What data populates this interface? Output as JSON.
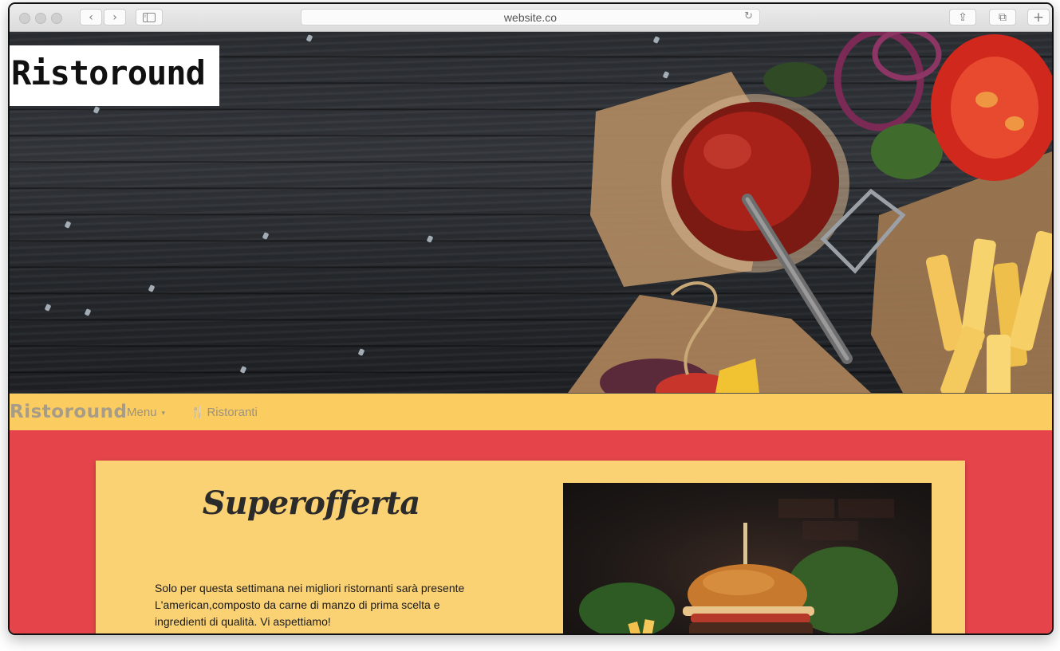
{
  "browser": {
    "url": "website.co",
    "back_icon": "‹",
    "forward_icon": "›",
    "reload_icon": "↻",
    "share_icon": "⇪",
    "tabs_icon": "⧉",
    "new_tab_icon": "+"
  },
  "hero": {
    "logo": "Ristoround"
  },
  "navbar": {
    "brand": "Ristoround",
    "menu_label": "Menu",
    "menu_caret": "▾",
    "restaurants_icon": "🍴",
    "restaurants_label": "Ristoranti"
  },
  "offer": {
    "title": "Superofferta",
    "text": "Solo per questa settimana nei migliori ristornanti sarà presente L'american,composto da carne di manzo di prima scelta e ingredienti di qualità. Vi aspettiamo!"
  },
  "colors": {
    "navbar_bg": "#fbcd60",
    "content_bg": "#e5454a",
    "card_bg": "#fad274"
  }
}
